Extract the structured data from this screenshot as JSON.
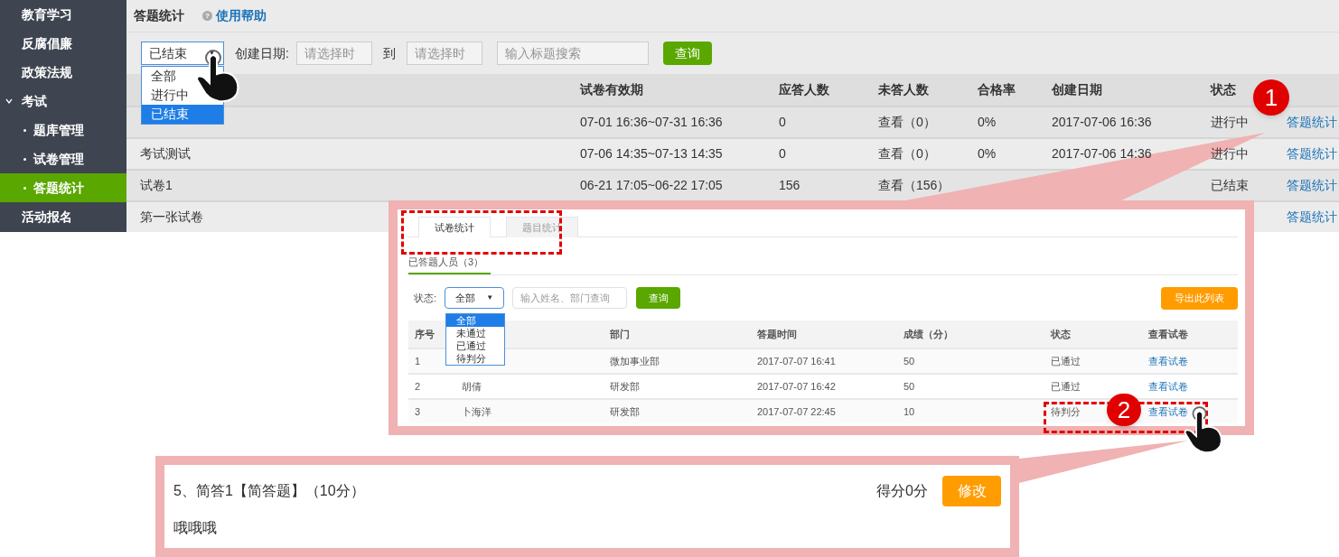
{
  "sidebar": {
    "items": [
      {
        "label": "教育学习",
        "selected": false
      },
      {
        "label": "反腐倡廉",
        "selected": false
      },
      {
        "label": "政策法规",
        "selected": false
      },
      {
        "label": "考试",
        "selected": false,
        "expanded": true,
        "children": [
          {
            "label": "题库管理",
            "selected": false
          },
          {
            "label": "试卷管理",
            "selected": false
          },
          {
            "label": "答题统计",
            "selected": true
          }
        ]
      },
      {
        "label": "活动报名",
        "selected": false
      }
    ]
  },
  "header": {
    "title": "答题统计",
    "help_icon": "?",
    "help": "使用帮助"
  },
  "filters": {
    "status_value": "已结束",
    "caret": "▼",
    "date_label": "创建日期:",
    "date_from_placeholder": "请选择时",
    "to_label": "到",
    "date_to_placeholder": "请选择时",
    "search_placeholder": "输入标题搜索",
    "button": "查询"
  },
  "status_dropdown": [
    {
      "label": "全部",
      "selected": false
    },
    {
      "label": "进行中",
      "selected": false
    },
    {
      "label": "已结束",
      "selected": true
    }
  ],
  "table": {
    "columns": [
      "试卷有效期",
      "应答人数",
      "未答人数",
      "合格率",
      "创建日期",
      "状态"
    ],
    "rows": [
      {
        "period": "07-01 16:36~07-31 16:36",
        "expected": "0",
        "unanswered": "查看（0）",
        "pass_rate": "0%",
        "created": "2017-07-06 16:36",
        "status": "进行中",
        "action": "答题统计"
      },
      {
        "name": "考试测试",
        "period": "07-06 14:35~07-13 14:35",
        "expected": "0",
        "unanswered": "查看（0）",
        "pass_rate": "0%",
        "created": "2017-07-06 14:36",
        "status": "进行中",
        "action": "答题统计"
      },
      {
        "name": "试卷1",
        "period": "06-21 17:05~06-22 17:05",
        "expected": "156",
        "unanswered": "查看（156）",
        "status": "已结束",
        "action": "答题统计"
      },
      {
        "name": "第一张试卷",
        "action": "答题统计"
      }
    ]
  },
  "callout_1": {
    "badge": "1",
    "tabs": [
      {
        "label": "试卷统计",
        "selected": true
      },
      {
        "label": "题目统计",
        "selected": false
      }
    ],
    "subtab": "已答题人员（3）",
    "status_label": "状态:",
    "status_value": "全部",
    "caret": "▼",
    "status_options": [
      {
        "label": "全部",
        "selected": true
      },
      {
        "label": "未通过",
        "selected": false
      },
      {
        "label": "已通过",
        "selected": false
      },
      {
        "label": "待判分",
        "selected": false
      }
    ],
    "search_placeholder": "输入姓名、部门查询",
    "button": "查询",
    "export_button": "导出此列表",
    "columns": [
      "序号",
      "部门",
      "答题时间",
      "成绩（分）",
      "状态",
      "查看试卷"
    ],
    "rows": [
      {
        "index": "1",
        "department": "微加事业部",
        "time": "2017-07-07 16:41",
        "score": "50",
        "status": "已通过",
        "link": "查看试卷"
      },
      {
        "index": "2",
        "name": "胡倩",
        "department": "研发部",
        "time": "2017-07-07 16:42",
        "score": "50",
        "status": "已通过",
        "link": "查看试卷"
      },
      {
        "index": "3",
        "name": "卜海洋",
        "department": "研发部",
        "time": "2017-07-07 22:45",
        "score": "10",
        "status": "待判分",
        "link": "查看试卷"
      }
    ]
  },
  "callout_2": {
    "badge": "2"
  },
  "callout_3": {
    "question": "5、简答1【简答题】（10分）",
    "score": "得分0分",
    "button": "修改",
    "answer": "哦哦哦"
  }
}
